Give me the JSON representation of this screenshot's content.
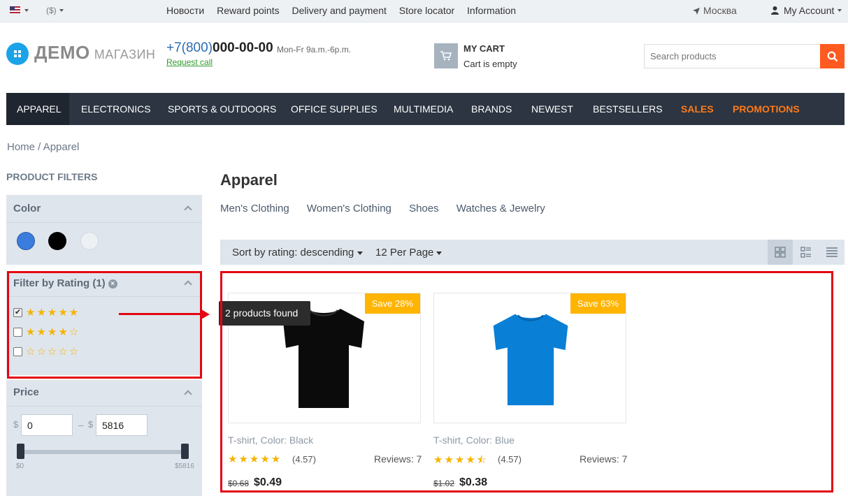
{
  "topbar": {
    "currency": "($)",
    "nav": [
      "Новости",
      "Reward points",
      "Delivery and payment",
      "Store locator",
      "Information"
    ],
    "city": "Москва",
    "account": "My Account"
  },
  "header": {
    "logo_main": "ДЕМО",
    "logo_sub": "МАГАЗИН",
    "phone_prefix": "+7(800)",
    "phone_number": "000-00-00",
    "hours": "Mon-Fr 9a.m.-6p.m.",
    "request_call": "Request call",
    "cart_title": "MY CART",
    "cart_status": "Cart is empty",
    "search_placeholder": "Search products"
  },
  "mainnav": [
    "APPAREL",
    "ELECTRONICS",
    "SPORTS & OUTDOORS",
    "OFFICE SUPPLIES",
    "MULTIMEDIA",
    "BRANDS",
    "NEWEST",
    "BESTSELLERS",
    "SALES",
    "PROMOTIONS"
  ],
  "breadcrumb": "Home  /  Apparel",
  "sidebar": {
    "title": "PRODUCT FILTERS",
    "color_title": "Color",
    "color_swatches": [
      "#3b7ddd",
      "#000000",
      "#eef1f4"
    ],
    "rating_title": "Filter by Rating (1)",
    "rating_rows": [
      {
        "stars": "★★★★★",
        "checked": true
      },
      {
        "stars": "★★★★☆",
        "checked": false
      },
      {
        "stars": "☆☆☆☆☆",
        "checked": false
      }
    ],
    "price_title": "Price",
    "currency_symbol": "$",
    "range_dash": "–",
    "price_min": "0",
    "price_max": "5816",
    "range_min_label": "$0",
    "range_max_label": "$5816"
  },
  "content": {
    "title": "Apparel",
    "subcategories": [
      "Men's Clothing",
      "Women's Clothing",
      "Shoes",
      "Watches & Jewelry"
    ],
    "sort_label": "Sort by rating: descending",
    "per_page_label": "12 Per Page",
    "tooltip": "2 products found",
    "products": [
      {
        "name": "T-shirt, Color: Black",
        "badge": "Save 28%",
        "stars": "★★★★★",
        "rating": "(4.57)",
        "reviews": "Reviews: 7",
        "old_price": "$0.68",
        "price": "$0.49",
        "color": "#0b0b0b"
      },
      {
        "name": "T-shirt, Color: Blue",
        "badge": "Save 63%",
        "stars": "★★★★⯪",
        "rating": "(4.57)",
        "reviews": "Reviews: 7",
        "old_price": "$1.02",
        "price": "$0.38",
        "color": "#0a7fd6"
      }
    ]
  },
  "colors": {
    "accent": "#ff5a1f",
    "nav_bg": "#2c3541",
    "highlight": "#e30613",
    "star": "#f5b300"
  }
}
